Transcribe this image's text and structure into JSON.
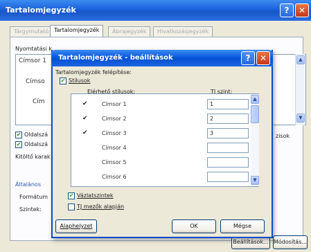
{
  "outer": {
    "title": "Tartalomjegyzék",
    "tabs": [
      "Tárgymutató",
      "Tartalomjegyzék",
      "Ábrajegyzék",
      "Hivatkozásjegyzék"
    ],
    "preview_label": "Nyomtatási k",
    "preview_lines": [
      "Címsor 1",
      "Címso",
      "Cím"
    ],
    "chk1_label": "Oldalszá",
    "chk2_label": "Oldalszá",
    "kitolto_label": "Kitöltő karak",
    "altalanos_label": "Általános",
    "formatum_label": "Formátum",
    "szintek_label": "Szintek:",
    "right_label": "zisok",
    "beallitasok_button": "Beállítások...",
    "modositas_button": "Módosítás..."
  },
  "inner": {
    "title": "Tartalomjegyzék - beállítások",
    "build_label": "Tartalomjegyzék felépítése:",
    "styles_chk_label": "Stílusok",
    "col_styles": "Elérhető stílusok:",
    "col_level": "TJ szint:",
    "rows": [
      {
        "name": "Címsor 1",
        "checked": "✔",
        "level": "1"
      },
      {
        "name": "Címsor 2",
        "checked": "✔",
        "level": "2"
      },
      {
        "name": "Címsor 3",
        "checked": "✔",
        "level": "3"
      },
      {
        "name": "Címsor 4",
        "checked": "",
        "level": ""
      },
      {
        "name": "Címsor 5",
        "checked": "",
        "level": ""
      },
      {
        "name": "Címsor 6",
        "checked": "",
        "level": ""
      }
    ],
    "outline_chk_label": "Vázlatszintek",
    "tj_chk_label": "TJ mezők alapján",
    "reset_button": "Alaphelyzet",
    "ok_button": "OK",
    "cancel_button": "Mégse",
    "check_mark": "✔"
  }
}
